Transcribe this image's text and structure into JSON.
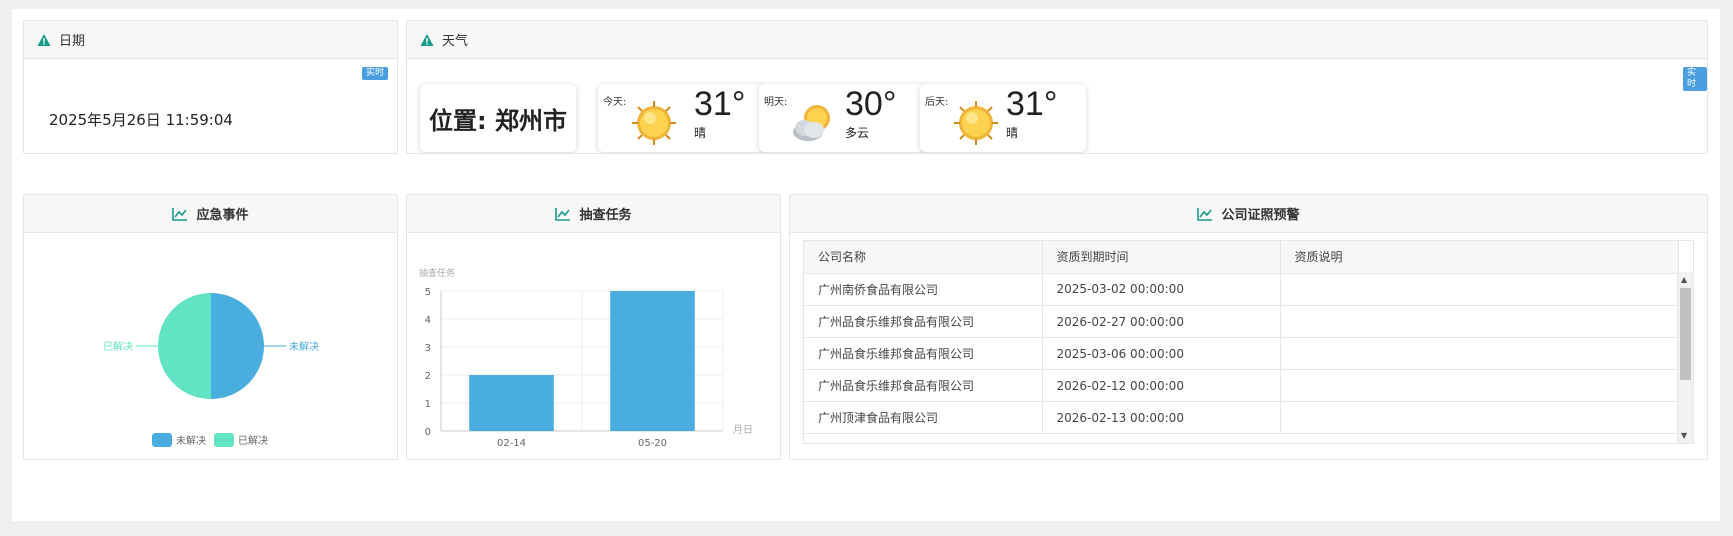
{
  "date_panel": {
    "title": "日期",
    "tag": "实时",
    "datetime": "2025年5月26日 11:59:04"
  },
  "weather_panel": {
    "title": "天气",
    "tag": "实时",
    "location": "位置: 郑州市",
    "days": [
      {
        "label": "今天:",
        "temp": "31°",
        "condition": "晴",
        "icon": "sun-icon"
      },
      {
        "label": "明天:",
        "temp": "30°",
        "condition": "多云",
        "icon": "partly-cloudy-icon"
      },
      {
        "label": "后天:",
        "temp": "31°",
        "condition": "晴",
        "icon": "sun-icon"
      }
    ]
  },
  "emergency_panel": {
    "title": "应急事件",
    "chart_data": {
      "type": "pie",
      "slices": [
        {
          "name": "未解决",
          "value": 1,
          "color": "#4aaddf"
        },
        {
          "name": "已解决",
          "value": 1,
          "color": "#61e3c4"
        }
      ],
      "legend": [
        "未解决",
        "已解决"
      ],
      "legend_position": "bottom"
    }
  },
  "inspection_panel": {
    "title": "抽查任务",
    "chart_data": {
      "type": "bar",
      "categories": [
        "02-14",
        "05-20"
      ],
      "values": [
        2,
        5
      ],
      "ylabel": "抽查任务",
      "xlabel": "月日",
      "ylim": [
        0,
        5
      ],
      "yticks": [
        "0",
        "1",
        "2",
        "3",
        "4",
        "5"
      ],
      "color": "#4aaddf",
      "grid": true
    }
  },
  "license_panel": {
    "title": "公司证照预警",
    "columns": [
      "公司名称",
      "资质到期时间",
      "资质说明"
    ],
    "rows": [
      [
        "广州南侨食品有限公司",
        "2025-03-02 00:00:00",
        ""
      ],
      [
        "广州品食乐维邦食品有限公司",
        "2026-02-27 00:00:00",
        ""
      ],
      [
        "广州品食乐维邦食品有限公司",
        "2025-03-06 00:00:00",
        ""
      ],
      [
        "广州品食乐维邦食品有限公司",
        "2026-02-12 00:00:00",
        ""
      ],
      [
        "广州顶津食品有限公司",
        "2026-02-13 00:00:00",
        ""
      ]
    ]
  }
}
